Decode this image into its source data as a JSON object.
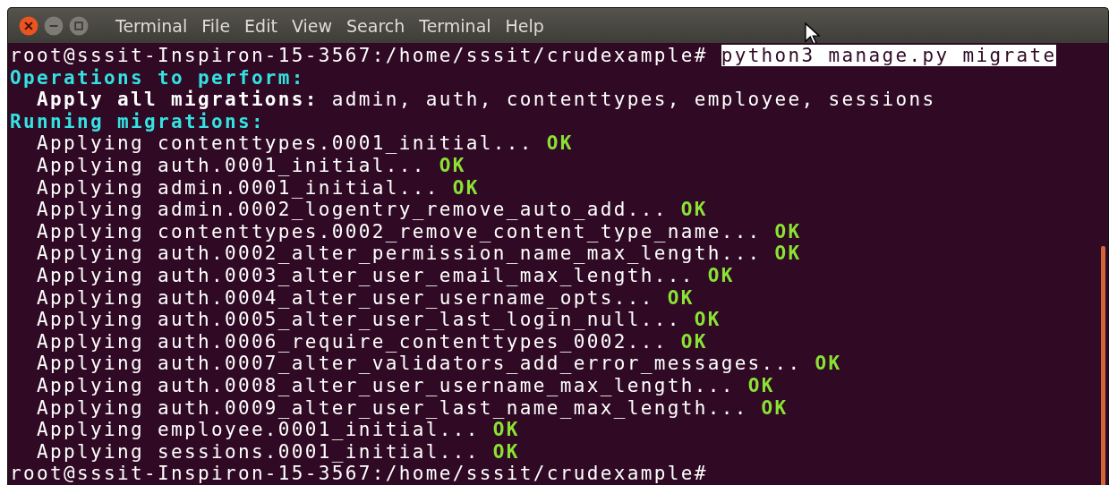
{
  "window": {
    "menu": [
      "Terminal",
      "File",
      "Edit",
      "View",
      "Search",
      "Terminal",
      "Help"
    ]
  },
  "lines": [
    {
      "segments": [
        {
          "kind": "prompt",
          "text": "root@sssit-Inspiron-15-3567:/home/sssit/crudexample# "
        },
        {
          "kind": "selected",
          "text": "python3 manage.py migrate"
        }
      ]
    },
    {
      "segments": [
        {
          "kind": "heading",
          "text": "Operations to perform:"
        }
      ]
    },
    {
      "segments": [
        {
          "kind": "bold",
          "text": "  Apply all migrations:"
        },
        {
          "kind": "plain",
          "text": " admin, auth, contenttypes, employee, sessions"
        }
      ]
    },
    {
      "segments": [
        {
          "kind": "heading",
          "text": "Running migrations:"
        }
      ]
    },
    {
      "segments": [
        {
          "kind": "plain",
          "text": "  Applying contenttypes.0001_initial..."
        },
        {
          "kind": "ok",
          "text": " OK"
        }
      ]
    },
    {
      "segments": [
        {
          "kind": "plain",
          "text": "  Applying auth.0001_initial..."
        },
        {
          "kind": "ok",
          "text": " OK"
        }
      ]
    },
    {
      "segments": [
        {
          "kind": "plain",
          "text": "  Applying admin.0001_initial..."
        },
        {
          "kind": "ok",
          "text": " OK"
        }
      ]
    },
    {
      "segments": [
        {
          "kind": "plain",
          "text": "  Applying admin.0002_logentry_remove_auto_add..."
        },
        {
          "kind": "ok",
          "text": " OK"
        }
      ]
    },
    {
      "segments": [
        {
          "kind": "plain",
          "text": "  Applying contenttypes.0002_remove_content_type_name..."
        },
        {
          "kind": "ok",
          "text": " OK"
        }
      ]
    },
    {
      "segments": [
        {
          "kind": "plain",
          "text": "  Applying auth.0002_alter_permission_name_max_length..."
        },
        {
          "kind": "ok",
          "text": " OK"
        }
      ]
    },
    {
      "segments": [
        {
          "kind": "plain",
          "text": "  Applying auth.0003_alter_user_email_max_length..."
        },
        {
          "kind": "ok",
          "text": " OK"
        }
      ]
    },
    {
      "segments": [
        {
          "kind": "plain",
          "text": "  Applying auth.0004_alter_user_username_opts..."
        },
        {
          "kind": "ok",
          "text": " OK"
        }
      ]
    },
    {
      "segments": [
        {
          "kind": "plain",
          "text": "  Applying auth.0005_alter_user_last_login_null..."
        },
        {
          "kind": "ok",
          "text": " OK"
        }
      ]
    },
    {
      "segments": [
        {
          "kind": "plain",
          "text": "  Applying auth.0006_require_contenttypes_0002..."
        },
        {
          "kind": "ok",
          "text": " OK"
        }
      ]
    },
    {
      "segments": [
        {
          "kind": "plain",
          "text": "  Applying auth.0007_alter_validators_add_error_messages..."
        },
        {
          "kind": "ok",
          "text": " OK"
        }
      ]
    },
    {
      "segments": [
        {
          "kind": "plain",
          "text": "  Applying auth.0008_alter_user_username_max_length..."
        },
        {
          "kind": "ok",
          "text": " OK"
        }
      ]
    },
    {
      "segments": [
        {
          "kind": "plain",
          "text": "  Applying auth.0009_alter_user_last_name_max_length..."
        },
        {
          "kind": "ok",
          "text": " OK"
        }
      ]
    },
    {
      "segments": [
        {
          "kind": "plain",
          "text": "  Applying employee.0001_initial..."
        },
        {
          "kind": "ok",
          "text": " OK"
        }
      ]
    },
    {
      "segments": [
        {
          "kind": "plain",
          "text": "  Applying sessions.0001_initial..."
        },
        {
          "kind": "ok",
          "text": " OK"
        }
      ]
    },
    {
      "segments": [
        {
          "kind": "prompt",
          "text": "root@sssit-Inspiron-15-3567:/home/sssit/crudexample# "
        }
      ]
    }
  ]
}
